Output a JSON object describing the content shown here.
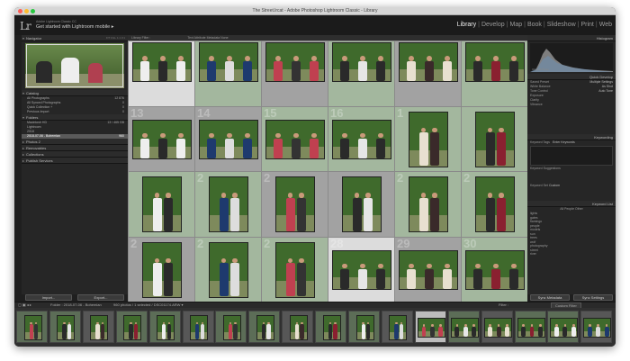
{
  "window": {
    "title": "The Street.lrcat - Adobe Photoshop Lightroom Classic - Library"
  },
  "identity": {
    "logo": "Lr",
    "subtitle": "Adobe Lightroom Classic CC",
    "task": "Get started with Lightroom mobile",
    "chevron": "▸"
  },
  "modules": [
    {
      "label": "Library",
      "active": true
    },
    {
      "label": "Develop",
      "active": false
    },
    {
      "label": "Map",
      "active": false
    },
    {
      "label": "Book",
      "active": false
    },
    {
      "label": "Slideshow",
      "active": false
    },
    {
      "label": "Print",
      "active": false
    },
    {
      "label": "Web",
      "active": false
    }
  ],
  "left_panel": {
    "navigator": {
      "title": "Navigator",
      "zoom": "FIT  FILL  1:1  3:1"
    },
    "catalog": {
      "title": "Catalog",
      "items": [
        {
          "label": "All Photographs",
          "count": "12 876"
        },
        {
          "label": "All Synced Photographs",
          "count": "0"
        },
        {
          "label": "Quick Collection +",
          "count": "0"
        },
        {
          "label": "Previous Import",
          "count": "0"
        }
      ]
    },
    "folders": {
      "title": "Folders",
      "items": [
        {
          "label": "Macintosh HD",
          "count": "13 / 465 GB"
        },
        {
          "label": "Lightroom",
          "count": ""
        },
        {
          "label": "2018",
          "count": ""
        },
        {
          "label": "2018-07-06 - Bohemian",
          "count": "960",
          "selected": true
        }
      ]
    },
    "collapsed": [
      "Photos 2",
      "Removables",
      "Collections",
      "Publish Services"
    ],
    "import_label": "Import...",
    "export_label": "Export..."
  },
  "filter_bar": {
    "label": "Library Filter :",
    "options": "Text   Attribute   Metadata   None"
  },
  "grid": {
    "cells": [
      {
        "num": "",
        "state": "sel",
        "o": "h"
      },
      {
        "num": "",
        "state": "pick",
        "o": "h"
      },
      {
        "num": "",
        "state": "norm",
        "o": "h"
      },
      {
        "num": "",
        "state": "pick",
        "o": "h"
      },
      {
        "num": "",
        "state": "norm",
        "o": "h"
      },
      {
        "num": "",
        "state": "pick",
        "o": "h"
      },
      {
        "num": "13",
        "state": "norm",
        "o": "h"
      },
      {
        "num": "14",
        "state": "norm",
        "o": "h"
      },
      {
        "num": "15",
        "state": "pick",
        "o": "h"
      },
      {
        "num": "16",
        "state": "pick",
        "o": "h"
      },
      {
        "num": "1",
        "state": "pick",
        "o": "v"
      },
      {
        "num": "",
        "state": "pick",
        "o": "v"
      },
      {
        "num": "",
        "state": "pick",
        "o": "v"
      },
      {
        "num": "2",
        "state": "pick",
        "o": "v"
      },
      {
        "num": "2",
        "state": "norm",
        "o": "v"
      },
      {
        "num": "",
        "state": "norm",
        "o": "v"
      },
      {
        "num": "2",
        "state": "pick",
        "o": "v"
      },
      {
        "num": "2",
        "state": "pick",
        "o": "v"
      },
      {
        "num": "2",
        "state": "norm",
        "o": "v"
      },
      {
        "num": "2",
        "state": "pick",
        "o": "v"
      },
      {
        "num": "2",
        "state": "pick",
        "o": "v"
      },
      {
        "num": "28",
        "state": "sel",
        "o": "h"
      },
      {
        "num": "29",
        "state": "norm",
        "o": "h"
      },
      {
        "num": "30",
        "state": "pick",
        "o": "h"
      }
    ]
  },
  "right_panel": {
    "histogram": {
      "title": "Histogram",
      "label": "Original Photo"
    },
    "quick_develop": {
      "title": "Quick Develop",
      "rows": [
        {
          "label": "Saved Preset",
          "value": "Multiple Settings"
        },
        {
          "label": "White Balance",
          "value": "As Shot"
        },
        {
          "label": "Tone Control",
          "value": "Auto Tone"
        },
        {
          "label": "Exposure",
          "value": ""
        },
        {
          "label": "Clarity",
          "value": ""
        },
        {
          "label": "Vibrance",
          "value": ""
        }
      ]
    },
    "keywording": {
      "title": "Keywording",
      "tags_label": "Keyword Tags",
      "tags_value": "Enter Keywords",
      "suggestions": "Keyword Suggestions",
      "set_label": "Keyword Set",
      "set_value": "Custom"
    },
    "keyword_list": {
      "title": "Keyword List",
      "filter": "All   People   Other",
      "rows": [
        "lights",
        "gates",
        "flamingo",
        "people",
        "models",
        "sun",
        "trees",
        "wolf",
        "photography",
        "street",
        "river"
      ]
    },
    "sync_metadata": "Sync Metadata",
    "sync_settings": "Sync Settings"
  },
  "filmstrip_bar": {
    "path": "Folder : 2018-07-06 - Bohemian",
    "info": "960 photos / 1 selected / DSC01174.ARW ▾",
    "filter_label": "Filter :",
    "filter_value": "Custom Filter"
  },
  "filmstrip": {
    "count": 18,
    "selected_index": 12
  },
  "colors": {
    "accent": "#e6e6e6",
    "pick_tint": "#a3b79e",
    "selected": "#dcdcdc"
  }
}
